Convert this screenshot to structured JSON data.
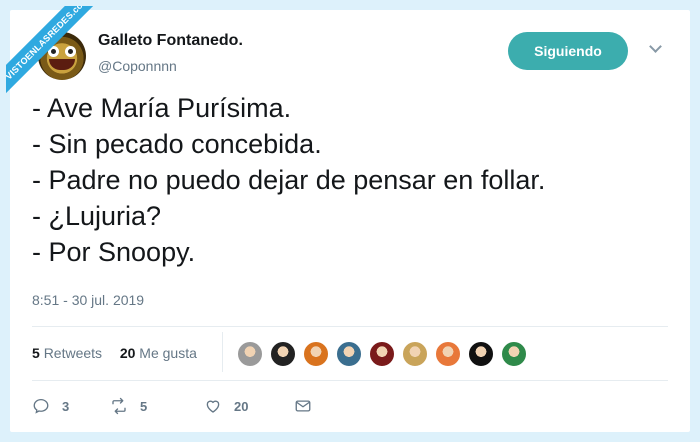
{
  "watermark": {
    "text": "VISTOENLASREDES",
    "subtext": ".com"
  },
  "user": {
    "display_name": "Galleto Fontanedo.",
    "handle": "@Coponnnn",
    "avatar_icon": "avatar-icon"
  },
  "follow_button": {
    "label": "Siguiendo",
    "color": "#3cadae"
  },
  "tweet": {
    "lines": [
      "- Ave María Purísima.",
      "- Sin pecado concebida.",
      "- Padre no puedo dejar de pensar en follar.",
      "- ¿Lujuria?",
      "- Por Snoopy."
    ],
    "timestamp": "8:51 - 30 jul. 2019"
  },
  "stats": {
    "retweets_count": "5",
    "retweets_label": "Retweets",
    "likes_count": "20",
    "likes_label": "Me gusta"
  },
  "likers": [
    {
      "name": "liker-1",
      "color": "#9a9a9a"
    },
    {
      "name": "liker-2",
      "color": "#222222"
    },
    {
      "name": "liker-3",
      "color": "#d9731e"
    },
    {
      "name": "liker-4",
      "color": "#3a6e8f"
    },
    {
      "name": "liker-5",
      "color": "#7a1a1a"
    },
    {
      "name": "liker-6",
      "color": "#c9a45a"
    },
    {
      "name": "liker-7",
      "color": "#e8783a"
    },
    {
      "name": "liker-8",
      "color": "#111111"
    },
    {
      "name": "liker-9",
      "color": "#2f8a4a"
    }
  ],
  "actions": {
    "reply_count": "3",
    "retweet_count": "5",
    "like_count": "20",
    "message_count": ""
  }
}
